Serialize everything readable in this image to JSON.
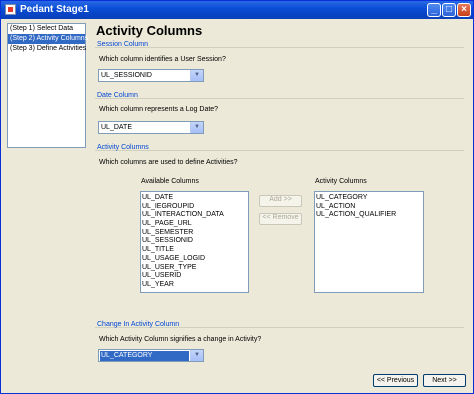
{
  "window": {
    "title": "Pedant Stage1"
  },
  "sidebar": {
    "items": [
      {
        "label": "(Step 1) Select Data",
        "selected": false
      },
      {
        "label": "(Step 2) Activity Columns",
        "selected": true
      },
      {
        "label": "(Step 3) Define Activities",
        "selected": false
      }
    ]
  },
  "page": {
    "title": "Activity Columns"
  },
  "session": {
    "section": "Session Column",
    "question": "Which column identifies a User Session?",
    "value": "UL_SESSIONID"
  },
  "date": {
    "section": "Date Column",
    "question": "Which column represents a Log Date?",
    "value": "UL_DATE"
  },
  "activity": {
    "section": "Activity Columns",
    "question": "Which columns are used to define Activities?",
    "available_label": "Available Columns",
    "available": [
      "UL_DATE",
      "UL_IEGROUPID",
      "UL_INTERACTION_DATA",
      "UL_PAGE_URL",
      "UL_SEMESTER",
      "UL_SESSIONID",
      "UL_TITLE",
      "UL_USAGE_LOGID",
      "UL_USER_TYPE",
      "UL_USERID",
      "UL_YEAR"
    ],
    "selected_label": "Activity Columns",
    "selected": [
      "UL_CATEGORY",
      "UL_ACTION",
      "UL_ACTION_QUALIFIER"
    ],
    "add_label": "Add >>",
    "remove_label": "<< Remove"
  },
  "change": {
    "section": "Change In Activity Column",
    "question": "Which Activity Column signifies a change in Activity?",
    "value": "UL_CATEGORY"
  },
  "nav": {
    "previous_label": "<< Previous",
    "next_label": "Next >>"
  }
}
